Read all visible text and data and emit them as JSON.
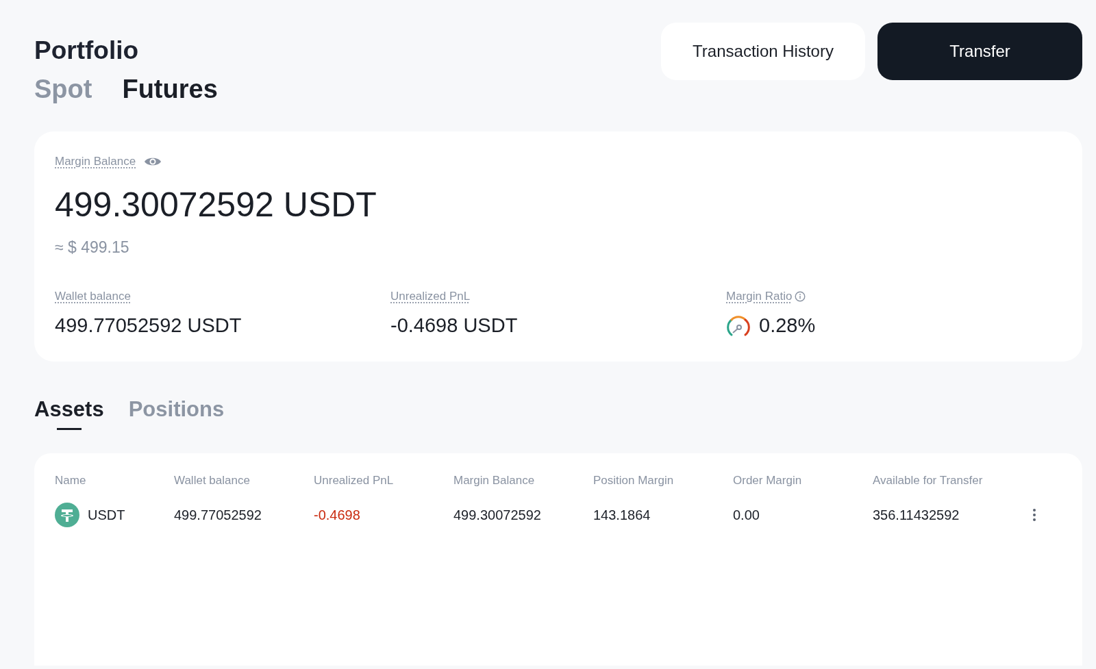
{
  "header": {
    "title": "Portfolio",
    "buttons": [
      {
        "label": "Transaction History",
        "kind": "secondary"
      },
      {
        "label": "Transfer",
        "kind": "primary"
      }
    ]
  },
  "tabs": [
    {
      "label": "Spot",
      "selected": false
    },
    {
      "label": "Futures",
      "selected": true
    }
  ],
  "summary": {
    "label": "Margin Balance",
    "amount": "499.30072592 USDT",
    "approx": "≈ $ 499.15",
    "metrics": [
      {
        "kind": "plain",
        "label": "Wallet balance",
        "value": "499.77052592 USDT"
      },
      {
        "kind": "plain",
        "label": "Unrealized PnL",
        "value": "-0.4698 USDT"
      },
      {
        "kind": "gauge",
        "label": "Margin Ratio",
        "value": "0.28%"
      }
    ]
  },
  "section_tabs": [
    {
      "label": "Assets",
      "selected": true
    },
    {
      "label": "Positions",
      "selected": false
    }
  ],
  "table": {
    "columns": [
      "Name",
      "Wallet balance",
      "Unrealized PnL",
      "Margin Balance",
      "Position Margin",
      "Order Margin",
      "Available for Transfer"
    ],
    "rows": [
      {
        "cells": [
          {
            "kind": "asset",
            "text": "USDT"
          },
          {
            "kind": "plain",
            "text": "499.77052592"
          },
          {
            "kind": "negative",
            "text": "-0.4698"
          },
          {
            "kind": "plain",
            "text": "499.30072592"
          },
          {
            "kind": "plain",
            "text": "143.1864"
          },
          {
            "kind": "plain",
            "text": "0.00"
          },
          {
            "kind": "plain",
            "text": "356.11432592"
          }
        ]
      }
    ]
  }
}
